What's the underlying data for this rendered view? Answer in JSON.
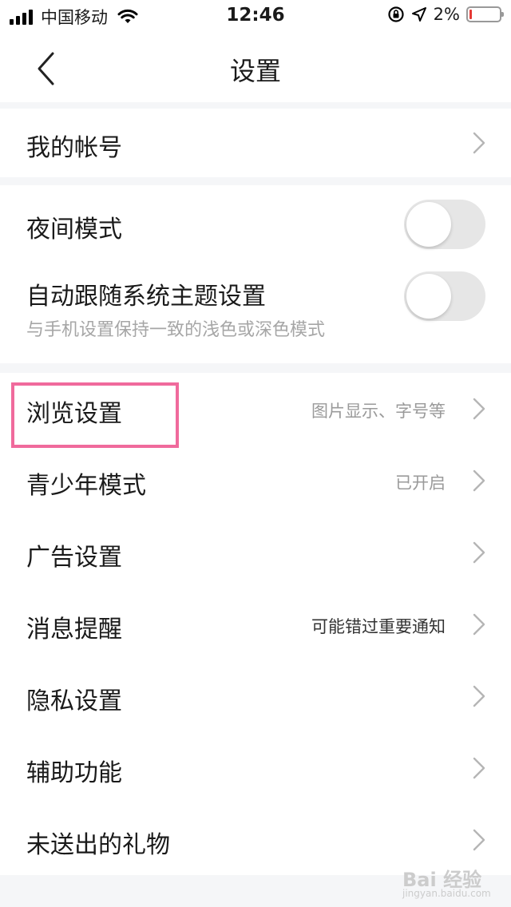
{
  "status_bar": {
    "carrier": "中国移动",
    "time": "12:46",
    "battery_percent": "2%",
    "battery_level": 0.02,
    "battery_color": "#e53935"
  },
  "nav": {
    "title": "设置",
    "back_icon": "chevron-left-icon"
  },
  "sections": {
    "account": {
      "label": "我的帐号"
    },
    "appearance": {
      "night_mode": {
        "label": "夜间模式",
        "on": false
      },
      "follow_system": {
        "label": "自动跟随系统主题设置",
        "sub": "与手机设置保持一致的浅色或深色模式",
        "on": false
      }
    },
    "general": [
      {
        "label": "浏览设置",
        "value": "图片显示、字号等"
      },
      {
        "label": "青少年模式",
        "value": "已开启"
      },
      {
        "label": "广告设置",
        "value": ""
      },
      {
        "label": "消息提醒",
        "value": "可能错过重要通知"
      },
      {
        "label": "隐私设置",
        "value": ""
      },
      {
        "label": "辅助功能",
        "value": ""
      },
      {
        "label": "未送出的礼物",
        "value": ""
      }
    ]
  },
  "annotation": {
    "color": "#f06a9c"
  },
  "watermark": {
    "text": "Bai 经验",
    "url": "jingyan.baidu.com"
  }
}
